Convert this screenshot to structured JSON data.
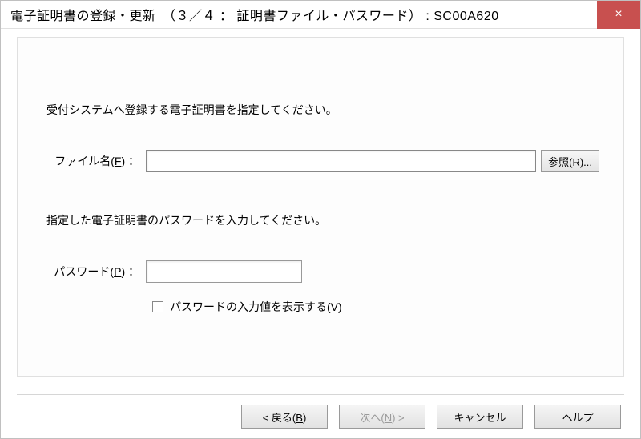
{
  "titlebar": {
    "title": "電子証明書の登録・更新　（３／４ ： 証明書ファイル・パスワード） : SC00A620",
    "close_icon": "×"
  },
  "panel": {
    "instruction_file": "受付システムへ登録する電子証明書を指定してください。",
    "file_label_prefix": "ファイル名(",
    "file_label_accel": "F",
    "file_label_suffix": ") ：",
    "file_value": "",
    "browse_prefix": "参照(",
    "browse_accel": "R",
    "browse_suffix": ")...",
    "instruction_pw": "指定した電子証明書のパスワードを入力してください。",
    "pw_label_prefix": "パスワード(",
    "pw_label_accel": "P",
    "pw_label_suffix": ") ：",
    "pw_value": "",
    "show_pw_prefix": "パスワードの入力値を表示する(",
    "show_pw_accel": "V",
    "show_pw_suffix": ")"
  },
  "buttons": {
    "back_prefix": "< 戻る(",
    "back_accel": "B",
    "back_suffix": ")",
    "next_prefix": "次へ(",
    "next_accel": "N",
    "next_suffix": ") >",
    "cancel": "キャンセル",
    "help": "ヘルプ"
  }
}
